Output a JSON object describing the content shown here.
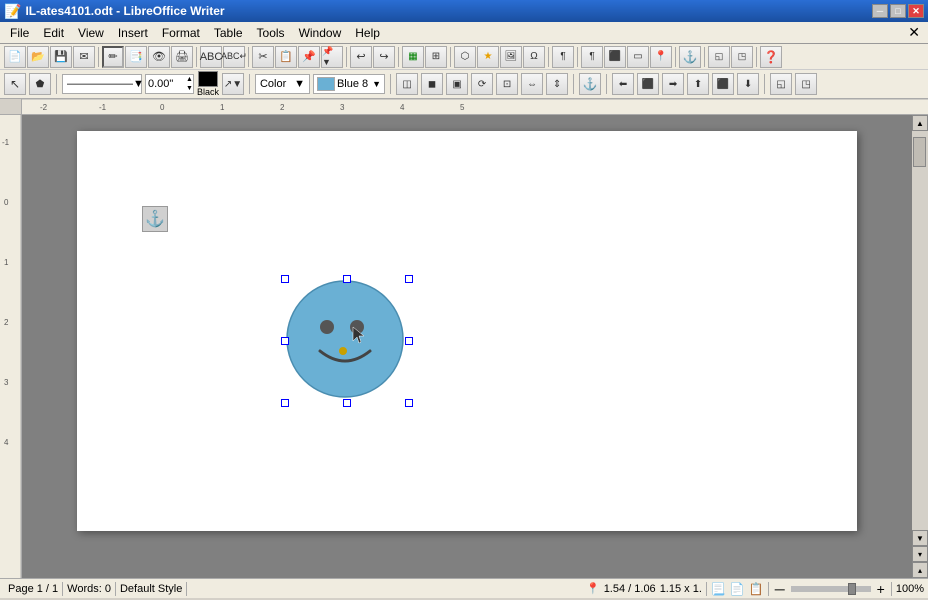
{
  "title": "IL-ates4101.odt - LibreOffice Writer",
  "titlebar": {
    "label": "IL-ates4101.odt - LibreOffice Writer",
    "minimize": "─",
    "maximize": "□",
    "close": "✕"
  },
  "menu": {
    "items": [
      "File",
      "Edit",
      "View",
      "Insert",
      "Format",
      "Table",
      "Tools",
      "Window",
      "Help"
    ],
    "close_icon": "✕"
  },
  "toolbar1": {
    "buttons": [
      "📄",
      "📁",
      "💾",
      "📧",
      "✏️",
      "🖨",
      "👁",
      "↩",
      "↪",
      "✂",
      "📋",
      "📌",
      "⬅",
      "➡",
      "🔍",
      "∑",
      "🅰",
      "📝",
      "🗃",
      "🔧",
      "❓"
    ]
  },
  "toolbar2": {
    "line_width": "0.00\"",
    "line_color": "Black",
    "arrow_btn": "↖",
    "color_mode": "Color",
    "fill_color": "Blue 8",
    "anchor_btn": "⚓"
  },
  "smiley": {
    "face_color": "#6ab0d4",
    "face_stroke": "#4a90b4",
    "eye_color": "#555",
    "mouth_color": "#555",
    "nose_color": "#c8a000",
    "size": 120
  },
  "statusbar": {
    "page": "Page 1 / 1",
    "words": "Words: 0",
    "style": "Default Style",
    "position": "1.54 / 1.06",
    "size": "1.15 x 1.",
    "zoom_pct": "100%",
    "zoom_minus": "─",
    "zoom_plus": "+"
  },
  "ruler": {
    "marks": [
      "-2",
      "-1",
      "0",
      "1",
      "2",
      "3",
      "4",
      "5"
    ]
  }
}
